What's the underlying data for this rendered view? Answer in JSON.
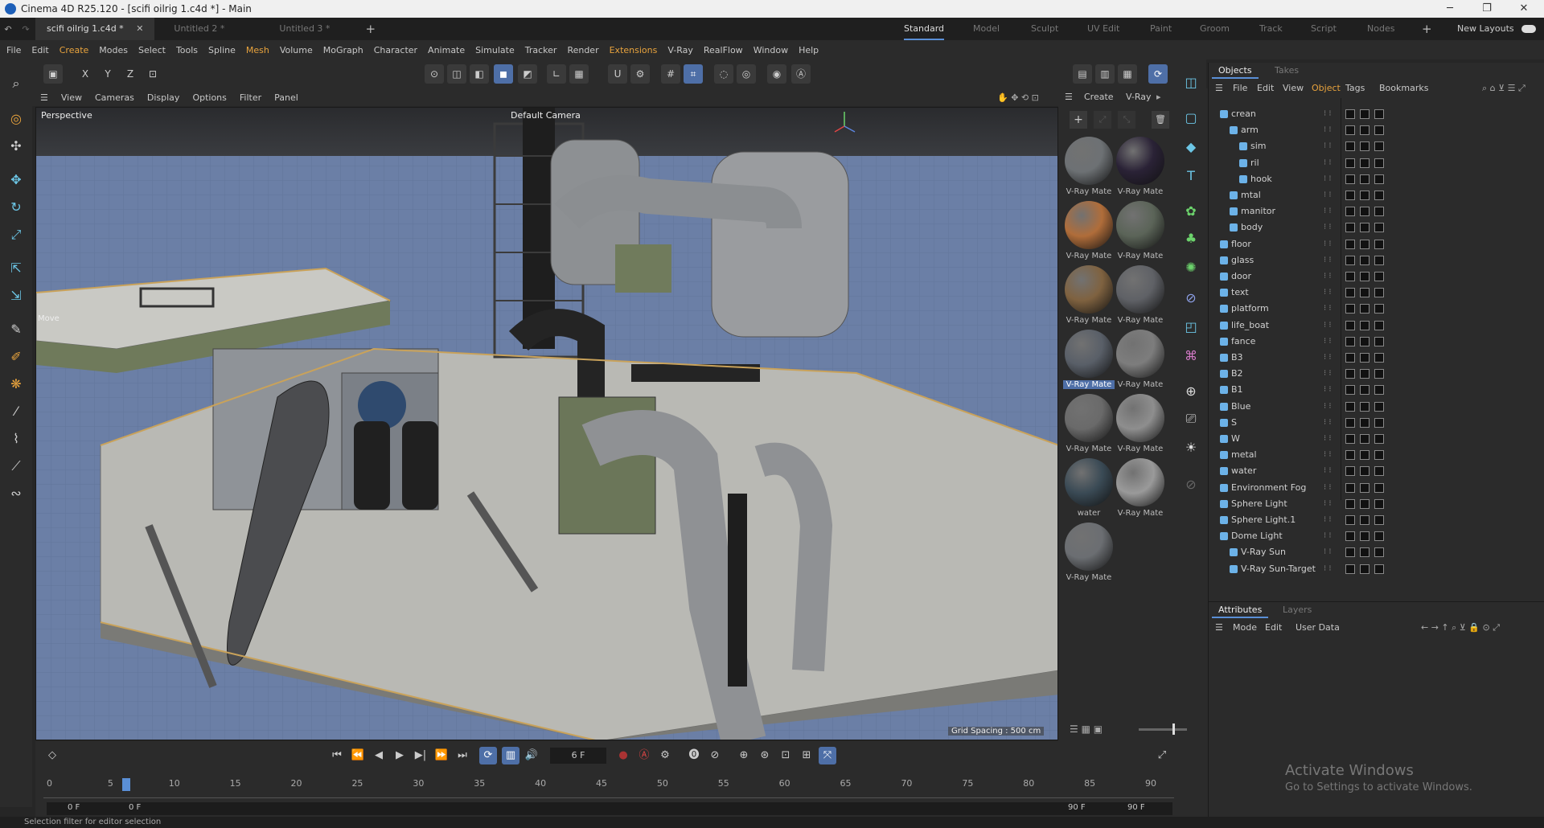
{
  "window": {
    "title": "Cinema 4D R25.120 - [scifi oilrig 1.c4d *] - Main"
  },
  "doc_tabs": [
    "scifi oilrig 1.c4d *",
    "Untitled 2 *",
    "Untitled 3 *"
  ],
  "layouts": [
    "Standard",
    "Model",
    "Sculpt",
    "UV Edit",
    "Paint",
    "Groom",
    "Track",
    "Script",
    "Nodes"
  ],
  "layouts_active": "Standard",
  "new_layouts": "New Layouts",
  "menu": [
    "File",
    "Edit",
    "Create",
    "Modes",
    "Select",
    "Tools",
    "Spline",
    "Mesh",
    "Volume",
    "MoGraph",
    "Character",
    "Animate",
    "Simulate",
    "Tracker",
    "Render",
    "Extensions",
    "V-Ray",
    "RealFlow",
    "Window",
    "Help"
  ],
  "axis_buttons": [
    "X",
    "Y",
    "Z"
  ],
  "viewport": {
    "menu": [
      "View",
      "Cameras",
      "Display",
      "Options",
      "Filter",
      "Panel"
    ],
    "label": "Perspective",
    "camera": "Default Camera",
    "move_label": "Move",
    "grid_spacing": "Grid Spacing : 500 cm",
    "colors": {
      "sky": "#6b7fa6",
      "deck": "#c8c8c4",
      "metal": "#8a8f96",
      "rail": "#c9a25a",
      "pipe_dark": "#2a2a2a"
    }
  },
  "material_panel": {
    "menu": [
      "Create",
      "V-Ray"
    ],
    "materials": [
      {
        "label": "V-Ray Mate",
        "color": "#6d7174"
      },
      {
        "label": "V-Ray Mate",
        "color": "#2a2236"
      },
      {
        "label": "V-Ray Mate",
        "color": "#b06d3a"
      },
      {
        "label": "V-Ray Mate",
        "color": "#5b6458"
      },
      {
        "label": "V-Ray Mate",
        "color": "#7f6240"
      },
      {
        "label": "V-Ray Mate",
        "color": "#5f6166"
      },
      {
        "label": "V-Ray Mate",
        "color": "#595f68",
        "selected": true
      },
      {
        "label": "V-Ray Mate",
        "color": "#7d7d7d"
      },
      {
        "label": "V-Ray Mate",
        "color": "#6a6a6a"
      },
      {
        "label": "V-Ray Mate",
        "color": "#8e8e8e"
      },
      {
        "label": "water",
        "color": "#3a4a55"
      },
      {
        "label": "V-Ray Mate",
        "color": "#9a9a9a"
      },
      {
        "label": "V-Ray Mate",
        "color": "#6b6e72"
      }
    ]
  },
  "objects_panel": {
    "tabs": [
      "Objects",
      "Takes"
    ],
    "menu": [
      "File",
      "Edit",
      "View",
      "Object",
      "Tags",
      "Bookmarks"
    ],
    "menu_active": "Object",
    "items": [
      {
        "name": "crean",
        "depth": 0
      },
      {
        "name": "arm",
        "depth": 1
      },
      {
        "name": "sim",
        "depth": 2
      },
      {
        "name": "ril",
        "depth": 2
      },
      {
        "name": "hook",
        "depth": 2
      },
      {
        "name": "mtal",
        "depth": 1
      },
      {
        "name": "manitor",
        "depth": 1
      },
      {
        "name": "body",
        "depth": 1
      },
      {
        "name": "floor",
        "depth": 0
      },
      {
        "name": "glass",
        "depth": 0
      },
      {
        "name": "door",
        "depth": 0
      },
      {
        "name": "text",
        "depth": 0
      },
      {
        "name": "platform",
        "depth": 0
      },
      {
        "name": "life_boat",
        "depth": 0
      },
      {
        "name": "fance",
        "depth": 0
      },
      {
        "name": "B3",
        "depth": 0
      },
      {
        "name": "B2",
        "depth": 0
      },
      {
        "name": "B1",
        "depth": 0
      },
      {
        "name": "Blue",
        "depth": 0
      },
      {
        "name": "S",
        "depth": 0
      },
      {
        "name": "W",
        "depth": 0
      },
      {
        "name": "metal",
        "depth": 0
      },
      {
        "name": "water",
        "depth": 0
      },
      {
        "name": "Environment Fog",
        "depth": 0
      },
      {
        "name": "Sphere Light",
        "depth": 0
      },
      {
        "name": "Sphere Light.1",
        "depth": 0
      },
      {
        "name": "Dome Light",
        "depth": 0
      },
      {
        "name": "V-Ray Sun",
        "depth": 1
      },
      {
        "name": "V-Ray Sun-Target",
        "depth": 1
      }
    ]
  },
  "attributes_panel": {
    "tabs": [
      "Attributes",
      "Layers"
    ],
    "menu": [
      "Mode",
      "Edit",
      "User Data"
    ]
  },
  "timeline": {
    "current_frame": "6 F",
    "start": "0 F",
    "start2": "0 F",
    "end": "90 F",
    "end2": "90 F",
    "ruler": [
      "0",
      "5",
      "10",
      "15",
      "20",
      "25",
      "30",
      "35",
      "40",
      "45",
      "50",
      "55",
      "60",
      "65",
      "70",
      "75",
      "80",
      "85",
      "90"
    ],
    "playhead_frame": 6
  },
  "status": "Selection filter for editor selection",
  "watermark": {
    "line1": "Activate Windows",
    "line2": "Go to Settings to activate Windows."
  }
}
